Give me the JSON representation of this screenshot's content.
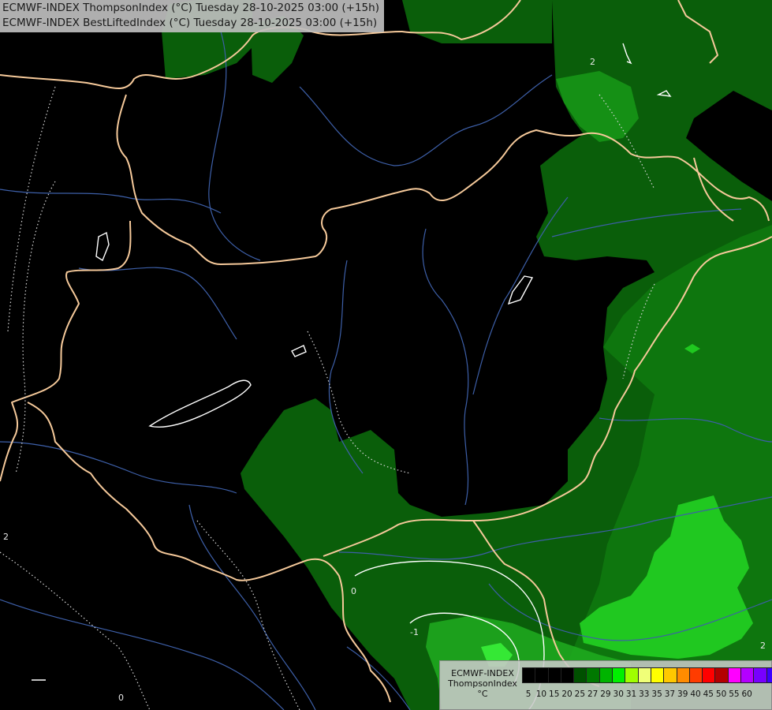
{
  "header": {
    "line1": "ECMWF-INDEX ThompsonIndex (°C) Tuesday 28-10-2025 03:00 (+15h)",
    "line2": "ECMWF-INDEX BestLiftedIndex (°C) Tuesday 28-10-2025 03:00 (+15h)"
  },
  "contour_labels": {
    "a": "2",
    "b": "2",
    "c": "0",
    "d": "-1",
    "e": "0",
    "f": "2"
  },
  "legend": {
    "line1": "ECMWF-INDEX",
    "line2": "ThompsonIndex",
    "unit": "°C",
    "ticks": [
      "5",
      "10",
      "15",
      "20",
      "25",
      "27",
      "29",
      "30",
      "31",
      "33",
      "35",
      "37",
      "39",
      "40",
      "45",
      "50",
      "55",
      "60"
    ],
    "colors": [
      "#000000",
      "#000000",
      "#000000",
      "#000000",
      "#005000",
      "#007800",
      "#00b400",
      "#00f000",
      "#a0ff00",
      "#f0ff78",
      "#ffff00",
      "#ffc800",
      "#ff8c00",
      "#ff3c00",
      "#ff0000",
      "#b40000",
      "#ff00ff",
      "#b400ff",
      "#7800ff",
      "#3c00ff",
      "#0000ff"
    ]
  },
  "colors": {
    "background": "#000000",
    "dark_green": "#0a5e0a",
    "mid_green": "#159015",
    "light_green": "#20c820",
    "bright_green": "#33ee33",
    "border": "#f5c99a",
    "river": "#3d5fa8"
  }
}
